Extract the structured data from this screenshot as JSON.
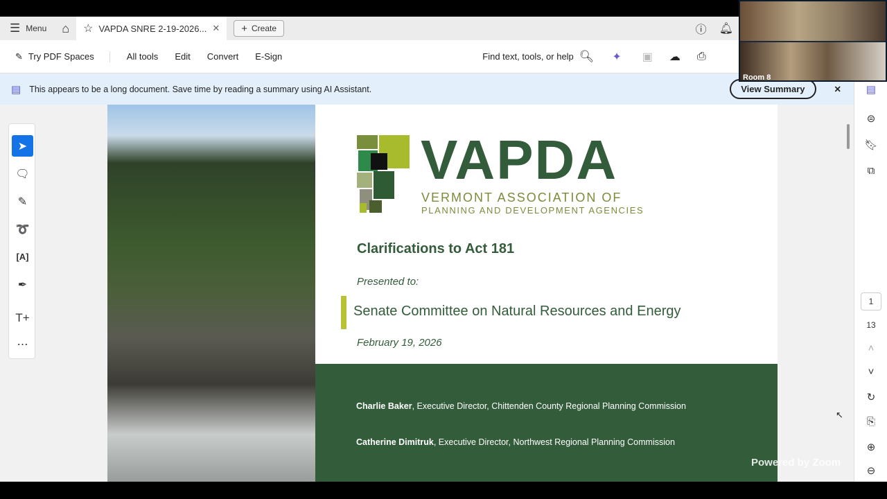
{
  "tabbar": {
    "menu": "Menu",
    "tab_title": "VAPDA SNRE 2-19-2026...",
    "create": "Create"
  },
  "toolbar": {
    "try_spaces": "Try PDF Spaces",
    "all_tools": "All tools",
    "edit": "Edit",
    "convert": "Convert",
    "esign": "E-Sign",
    "search": "Find text, tools, or help"
  },
  "banner": {
    "text": "This appears to be a long document. Save time by reading a summary using AI Assistant.",
    "button": "View Summary"
  },
  "document": {
    "logo_name": "VAPDA",
    "logo_line1": "VERMONT ASSOCIATION OF",
    "logo_line2": "PLANNING AND DEVELOPMENT AGENCIES",
    "title": "Clarifications to Act 181",
    "presented": "Presented to:",
    "committee": "Senate Committee on Natural Resources and Energy",
    "date": "February 19, 2026",
    "presenters": [
      {
        "name": "Charlie Baker",
        "role": ", Executive Director, Chittenden County Regional Planning Commission"
      },
      {
        "name": "Catherine Dimitruk",
        "role": ", Executive Director, Northwest Regional Planning Commission"
      }
    ]
  },
  "pager": {
    "current": "1",
    "total": "13"
  },
  "video": {
    "room": "Room 8",
    "watermark": "Powered by Zoom"
  },
  "colors": {
    "brand_green": "#335c3a",
    "accent": "#1473e6",
    "lime": "#b5c334"
  }
}
